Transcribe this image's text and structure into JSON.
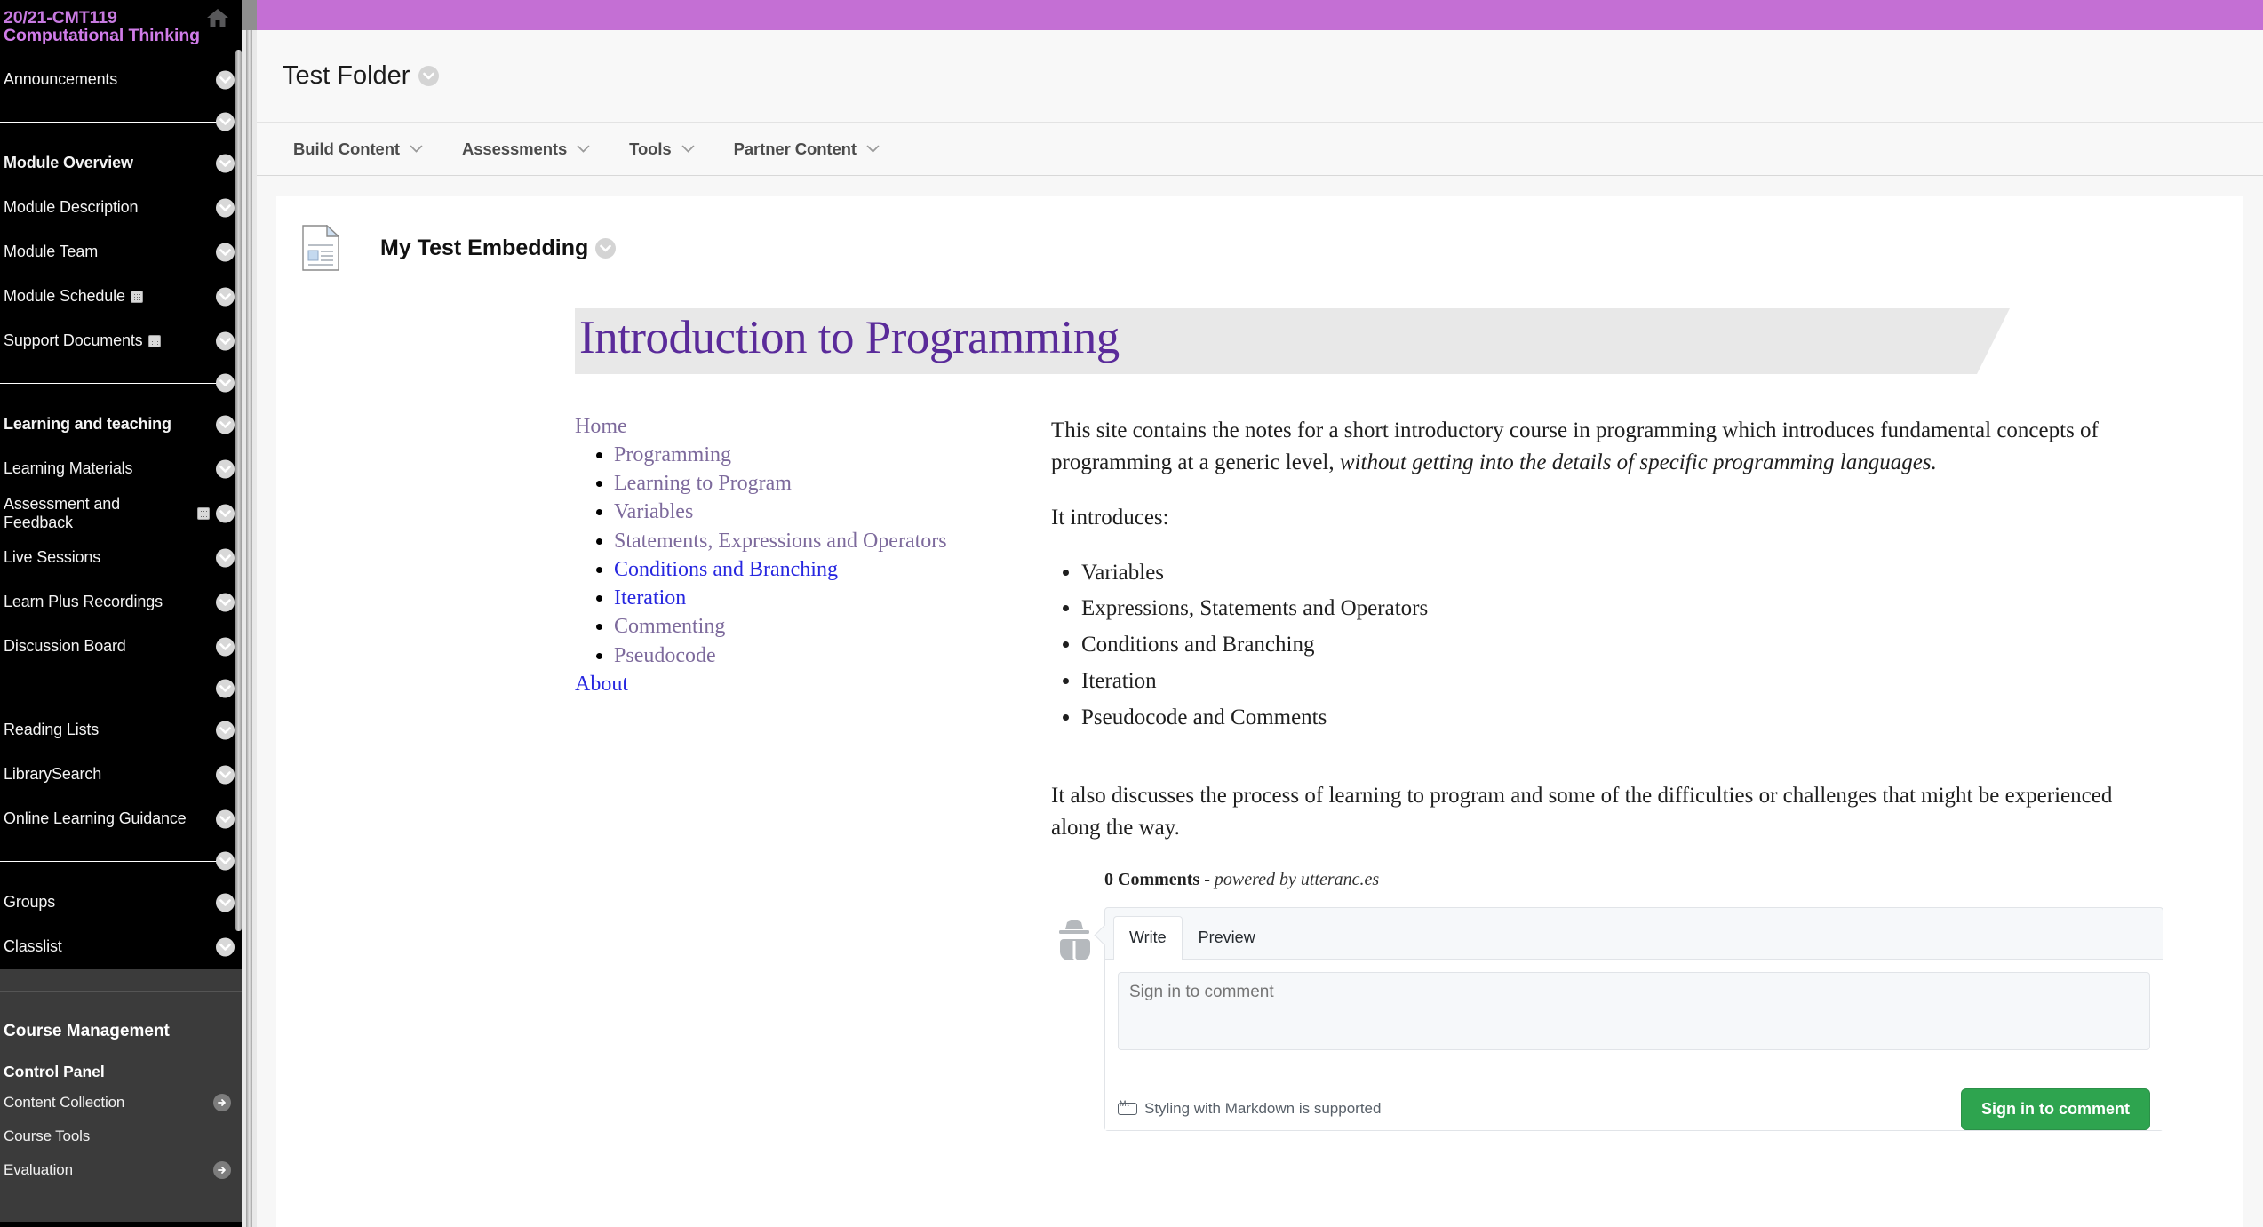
{
  "sidebar": {
    "course_code": "20/21-CMT119",
    "course_name": "Computational Thinking",
    "home_icon": "home-icon",
    "nav": [
      {
        "label": "Announcements",
        "type": "item",
        "bold": false,
        "badge": false
      },
      {
        "label": "",
        "type": "divider",
        "bold": false,
        "badge": false
      },
      {
        "label": "Module Overview",
        "type": "item",
        "bold": true,
        "badge": false
      },
      {
        "label": "Module Description",
        "type": "item",
        "bold": false,
        "badge": false
      },
      {
        "label": "Module Team",
        "type": "item",
        "bold": false,
        "badge": false
      },
      {
        "label": "Module Schedule",
        "type": "item",
        "bold": false,
        "badge": true
      },
      {
        "label": "Support Documents",
        "type": "item",
        "bold": false,
        "badge": true
      },
      {
        "label": "",
        "type": "divider",
        "bold": false,
        "badge": false
      },
      {
        "label": "Learning and teaching",
        "type": "item",
        "bold": true,
        "badge": false
      },
      {
        "label": "Learning Materials",
        "type": "item",
        "bold": false,
        "badge": false
      },
      {
        "label": "Assessment and Feedback",
        "type": "item",
        "bold": false,
        "badge": true
      },
      {
        "label": "Live Sessions",
        "type": "item",
        "bold": false,
        "badge": false
      },
      {
        "label": "Learn Plus Recordings",
        "type": "item",
        "bold": false,
        "badge": false
      },
      {
        "label": "Discussion Board",
        "type": "item",
        "bold": false,
        "badge": false
      },
      {
        "label": "",
        "type": "divider",
        "bold": false,
        "badge": false
      },
      {
        "label": "Reading Lists",
        "type": "item",
        "bold": false,
        "badge": false
      },
      {
        "label": "LibrarySearch",
        "type": "item",
        "bold": false,
        "badge": false
      },
      {
        "label": "Online Learning Guidance",
        "type": "item",
        "bold": false,
        "badge": false
      },
      {
        "label": "",
        "type": "divider",
        "bold": false,
        "badge": false
      },
      {
        "label": "Groups",
        "type": "item",
        "bold": false,
        "badge": false
      },
      {
        "label": "Classlist",
        "type": "item",
        "bold": false,
        "badge": false
      }
    ],
    "course_management": {
      "heading": "Course Management",
      "control_panel": "Control Panel",
      "items": [
        {
          "label": "Content Collection",
          "arrow": true
        },
        {
          "label": "Course Tools",
          "arrow": false
        },
        {
          "label": "Evaluation",
          "arrow": true
        }
      ]
    }
  },
  "header": {
    "folder_title": "Test Folder",
    "folder_chevron": "chevron-down-circle-icon"
  },
  "action_bar": {
    "menus": [
      {
        "label": "Build Content"
      },
      {
        "label": "Assessments"
      },
      {
        "label": "Tools"
      },
      {
        "label": "Partner Content"
      }
    ]
  },
  "content_item": {
    "icon": "document-icon",
    "title": "My Test Embedding",
    "chevron": "chevron-down-circle-icon"
  },
  "embedded_site": {
    "banner_title": "Introduction to Programming",
    "banner_color": "#5a2b9a",
    "toc": {
      "home": {
        "label": "Home",
        "state": "visited"
      },
      "items": [
        {
          "label": "Programming",
          "state": "visited"
        },
        {
          "label": "Learning to Program",
          "state": "visited"
        },
        {
          "label": "Variables",
          "state": "visited"
        },
        {
          "label": "Statements, Expressions and Operators",
          "state": "visited"
        },
        {
          "label": "Conditions and Branching",
          "state": "unvisited"
        },
        {
          "label": "Iteration",
          "state": "unvisited"
        },
        {
          "label": "Commenting",
          "state": "visited"
        },
        {
          "label": "Pseudocode",
          "state": "visited"
        }
      ],
      "about": {
        "label": "About",
        "state": "unvisited"
      }
    },
    "article": {
      "para1_plain": "This site contains the notes for a short introductory course in programming which introduces fundamental concepts of programming at a generic level, ",
      "para1_italic": "without getting into the details of specific programming languages.",
      "para2": "It introduces:",
      "bullets": [
        "Variables",
        "Expressions, Statements and Operators",
        "Conditions and Branching",
        "Iteration",
        "Pseudocode and Comments"
      ],
      "para3": "It also discusses the process of learning to program and some of the difficulties or challenges that might be experienced along the way."
    },
    "comments": {
      "count_label": "0 Comments",
      "powered_dash": " - ",
      "powered_by": "powered by utteranc.es",
      "avatar_icon": "incognito-avatar-icon",
      "tabs": [
        {
          "label": "Write",
          "active": true
        },
        {
          "label": "Preview",
          "active": false
        }
      ],
      "textarea_placeholder": "Sign in to comment",
      "markdown_icon": "markdown-icon",
      "markdown_note": "Styling with Markdown is supported",
      "signin_button": "Sign in to comment",
      "signin_button_color": "#2ea44f"
    }
  }
}
